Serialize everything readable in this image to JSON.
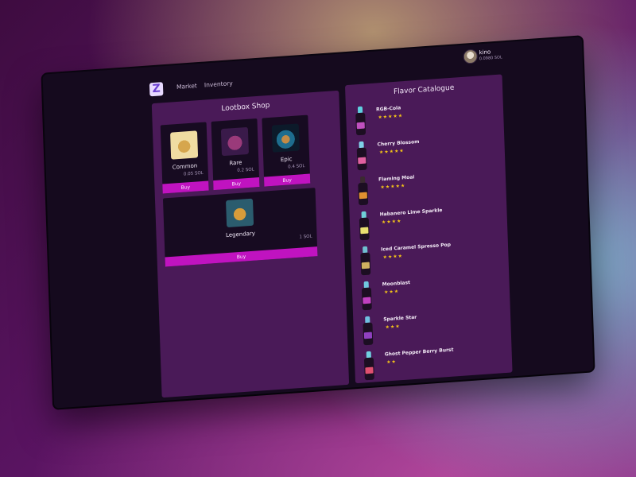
{
  "nav": {
    "market_label": "Market",
    "inventory_label": "Inventory"
  },
  "user": {
    "name": "kino",
    "balance": "0.0980 SOL"
  },
  "shop": {
    "title": "Lootbox Shop",
    "boxes": [
      {
        "name": "Common",
        "price": "0.05 SOL",
        "buy_label": "Buy",
        "icon": "chest-common-icon"
      },
      {
        "name": "Rare",
        "price": "0.2 SOL",
        "buy_label": "Buy",
        "icon": "chest-rare-icon"
      },
      {
        "name": "Epic",
        "price": "0.4 SOL",
        "buy_label": "Buy",
        "icon": "chest-epic-icon"
      },
      {
        "name": "Legendary",
        "price": "1 SOL",
        "buy_label": "Buy",
        "icon": "chest-legendary-icon"
      }
    ]
  },
  "catalogue": {
    "title": "Flavor Catalogue",
    "flavors": [
      {
        "name": "RGB-Cola",
        "stars": "★★★★★",
        "rating": 5,
        "cap_color": "#5fd0e0",
        "label_color": "#c050c0"
      },
      {
        "name": "Cherry Blossom",
        "stars": "★★★★★",
        "rating": 5,
        "cap_color": "#7fd0e8",
        "label_color": "#e060a0"
      },
      {
        "name": "Flaming Moai",
        "stars": "★★★★★",
        "rating": 5,
        "cap_color": "#3a2a30",
        "label_color": "#e09030"
      },
      {
        "name": "Habanero Lime Sparkle",
        "stars": "★★★★",
        "rating": 4,
        "cap_color": "#6fd0d8",
        "label_color": "#e8e070"
      },
      {
        "name": "Iced Caramel Spresso Pop",
        "stars": "★★★★",
        "rating": 4,
        "cap_color": "#6fc0d0",
        "label_color": "#d0b060"
      },
      {
        "name": "Moonblast",
        "stars": "★★★",
        "rating": 3,
        "cap_color": "#70c8e0",
        "label_color": "#c040c0"
      },
      {
        "name": "Sparkle Star",
        "stars": "★★★",
        "rating": 3,
        "cap_color": "#70c0e0",
        "label_color": "#9040c0"
      },
      {
        "name": "Ghost Pepper Berry Burst",
        "stars": "★★",
        "rating": 2,
        "cap_color": "#70d0e0",
        "label_color": "#e05070"
      }
    ]
  }
}
